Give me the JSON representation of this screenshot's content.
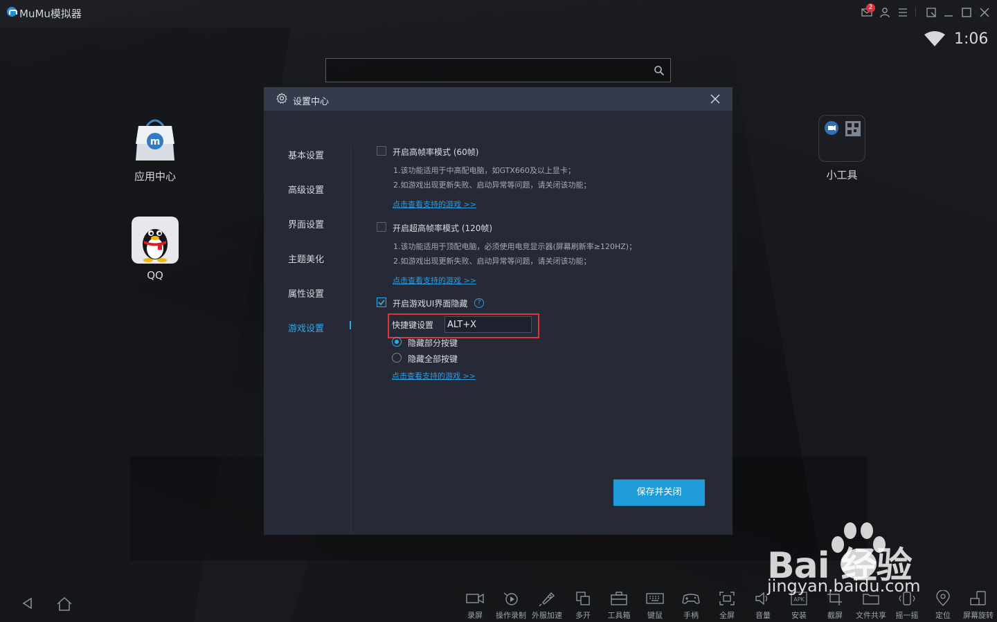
{
  "window": {
    "title": "MuMu模拟器",
    "mail_badge": "2",
    "clock": "1:06"
  },
  "desktop": {
    "apps": [
      {
        "label": "应用中心",
        "icon": "shopping-bag-icon"
      },
      {
        "label": "QQ",
        "icon": "qq-penguin-icon"
      },
      {
        "label": "小工具",
        "icon": "widget-tools-icon"
      }
    ]
  },
  "search": {
    "value": "",
    "placeholder": ""
  },
  "modal": {
    "title": "设置中心",
    "nav": [
      "基本设置",
      "高级设置",
      "界面设置",
      "主题美化",
      "属性设置",
      "游戏设置"
    ],
    "active_nav": "游戏设置",
    "options": {
      "high_fps": {
        "label": "开启高帧率模式 (60帧)",
        "checked": false,
        "desc1": "1.该功能适用于中高配电脑，如GTX660及以上显卡；",
        "desc2": "2.如游戏出现更新失败、启动异常等问题，请关闭该功能；",
        "link": "点击查看支持的游戏 >>"
      },
      "ultra_fps": {
        "label": "开启超高帧率模式 (120帧)",
        "checked": false,
        "desc1": "1.该功能适用于顶配电脑，必须使用电竞显示器(屏幕刷新率≥120HZ)；",
        "desc2": "2.如游戏出现更新失败、启动异常等问题，请关闭该功能；",
        "link": "点击查看支持的游戏 >>"
      },
      "hide_ui": {
        "label": "开启游戏UI界面隐藏",
        "checked": true,
        "hotkey_label": "快捷键设置",
        "hotkey_value": "ALT+X",
        "radio_partial": "隐藏部分按键",
        "radio_all": "隐藏全部按键",
        "selected": "隐藏部分按键",
        "link": "点击查看支持的游戏 >>"
      }
    },
    "save_label": "保存并关闭"
  },
  "toolbar": {
    "items": [
      {
        "label": "录屏",
        "icon": "camera-record-icon"
      },
      {
        "label": "操作录制",
        "icon": "macro-record-icon"
      },
      {
        "label": "外服加速",
        "icon": "rocket-icon"
      },
      {
        "label": "多开",
        "icon": "multi-window-icon"
      },
      {
        "label": "工具箱",
        "icon": "toolbox-icon"
      },
      {
        "label": "键鼠",
        "icon": "keyboard-icon"
      },
      {
        "label": "手柄",
        "icon": "gamepad-icon"
      },
      {
        "label": "全屏",
        "icon": "fullscreen-icon"
      },
      {
        "label": "音量",
        "icon": "volume-icon"
      },
      {
        "label": "安装",
        "icon": "apk-install-icon"
      },
      {
        "label": "截屏",
        "icon": "crop-icon"
      },
      {
        "label": "文件共享",
        "icon": "folder-share-icon"
      },
      {
        "label": "摇一摇",
        "icon": "shake-icon"
      },
      {
        "label": "定位",
        "icon": "location-icon"
      },
      {
        "label": "屏幕旋转",
        "icon": "rotate-screen-icon"
      }
    ]
  },
  "watermark": {
    "brand": "Bai 经验",
    "url": "jingyan.baidu.com"
  }
}
